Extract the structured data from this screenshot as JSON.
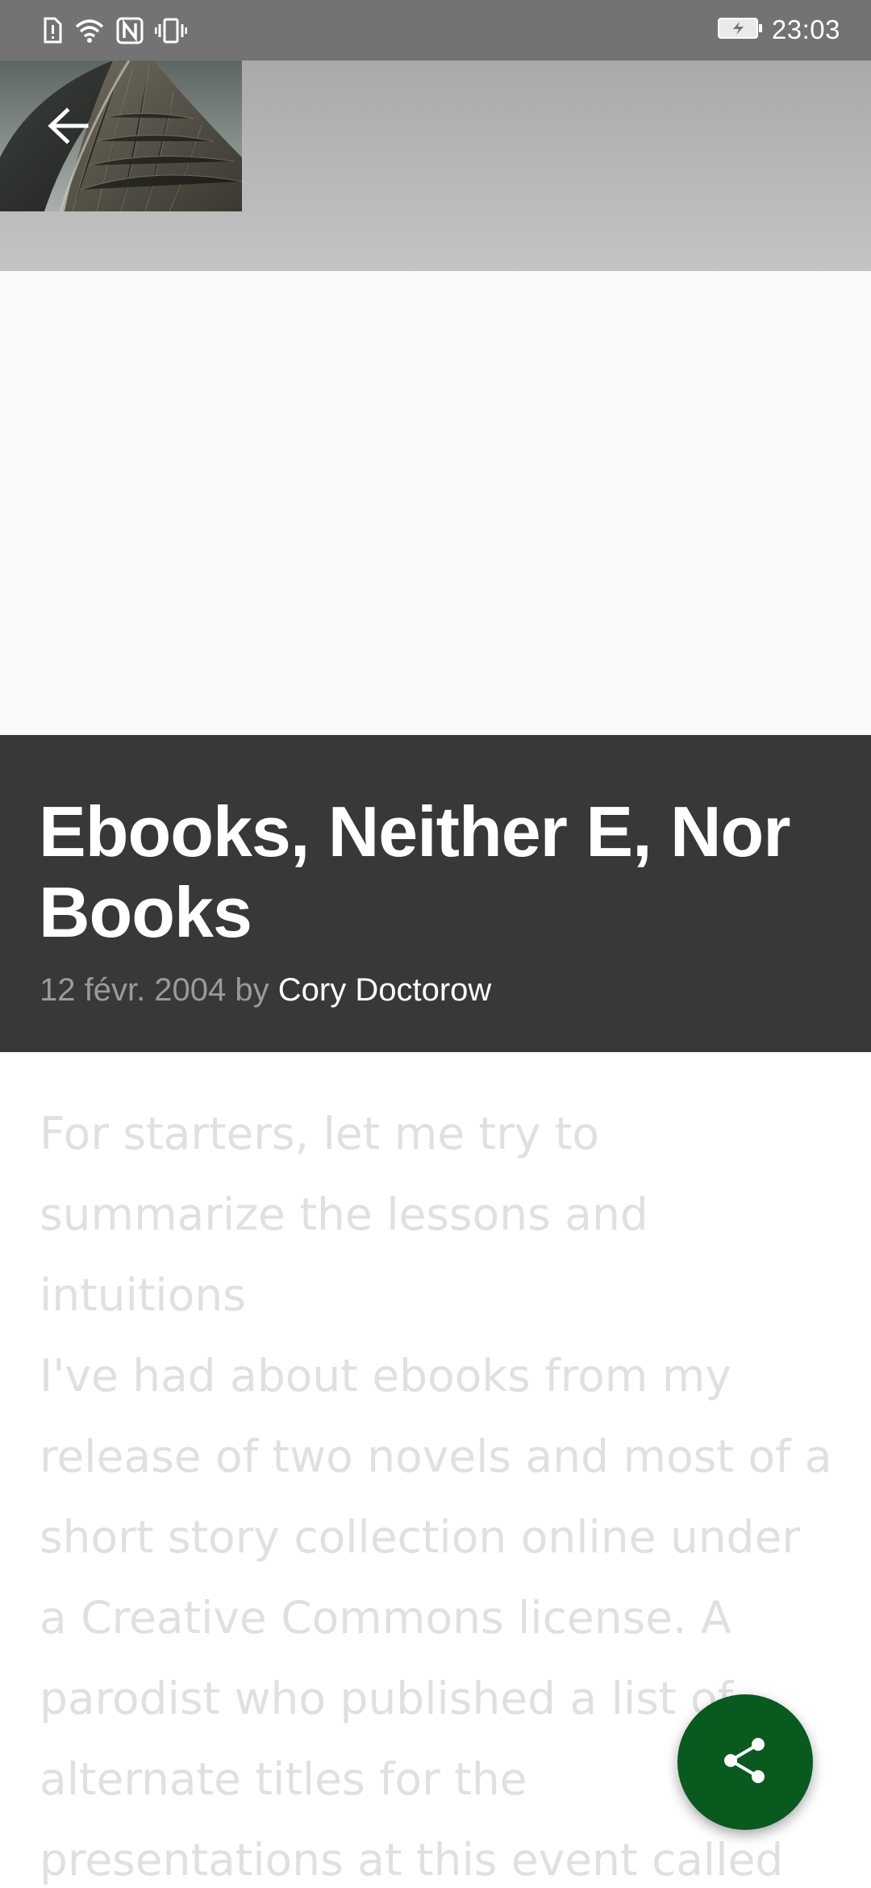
{
  "status_bar": {
    "time": "23:03",
    "icons": [
      "sim-alert-icon",
      "wifi-icon",
      "nfc-icon",
      "vibrate-icon",
      "battery-charging-icon"
    ]
  },
  "header": {
    "back_icon": "arrow-back-icon",
    "hero_image": "architecture-roof-thumbnail"
  },
  "article": {
    "title": "Ebooks, Neither E, Nor Books",
    "date": "12 févr. 2004",
    "by": "by",
    "author": "Cory Doctorow",
    "body": "For starters, let me try to\nsummarize the lessons and\nintuitions\nI've had about ebooks from my\nrelease of two novels and most of a\nshort story collection online under\na Creative Commons license. A\nparodist who published a list of\nalternate titles for the\npresentations at this event called"
  },
  "fab": {
    "icon": "share-icon",
    "color": "#085a1e"
  },
  "colors": {
    "title_background": "#383838",
    "status_bar": "#737373"
  }
}
